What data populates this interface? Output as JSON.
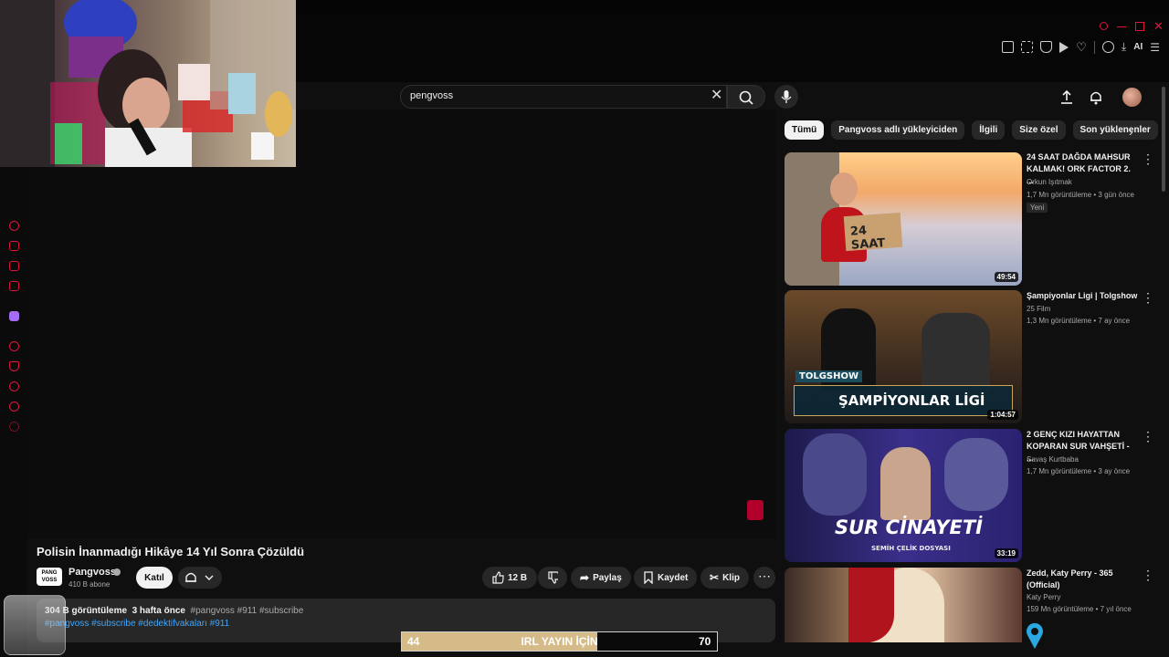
{
  "search": {
    "query": "pengvoss"
  },
  "chips": [
    "Tümü",
    "Pangvoss adlı yükleyiciden",
    "İlgili",
    "Size özel",
    "Son yüklenenler"
  ],
  "toolbar": {
    "ai_label": "AI"
  },
  "video": {
    "title": "Polisin İnanmadığı Hikâye 14 Yıl Sonra Çözüldü",
    "channel": "Pangvoss",
    "channel_logo": "PANG VOSS",
    "subscribers": "410 B abone",
    "join_label": "Katıl",
    "likes": "12 B",
    "share_label": "Paylaş",
    "save_label": "Kaydet",
    "clip_label": "Klip",
    "views": "304 B görüntüleme",
    "age": "3 hafta önce",
    "tags_line1": "#pangvoss #911 #subscribe",
    "tags_line2": "#pangvoss  #subscribe #dedektifvakaları #911"
  },
  "goal": {
    "left": "44",
    "label": "IRL YAYIN İÇİN",
    "right": "70",
    "progress_fraction": 0.62
  },
  "recommendations": [
    {
      "title": "24 SAAT DAĞDA MAHSUR KALMAK! ORK FACTOR 2. ...",
      "channel": "Orkun Işıtmak",
      "meta": "1,7 Mn görüntüleme • 3 gün önce",
      "badge": "Yeni",
      "duration": "49:54",
      "thumb_text": "24 SAAT"
    },
    {
      "title": "Şampiyonlar Ligi | Tolgshow",
      "channel": "25 Film",
      "meta": "1,3 Mn görüntüleme • 7 ay önce",
      "duration": "1:04:57",
      "thumb_text": "ŞAMPİYONLAR LİGİ",
      "thumb_text2": "TOLGSHOW"
    },
    {
      "title": "2 GENÇ KIZI HAYATTAN KOPARAN SUR VAHŞETİ - ...",
      "channel": "Savaş Kurtbaba",
      "meta": "1,7 Mn görüntüleme • 3 ay önce",
      "duration": "33:19",
      "thumb_text": "SUR CİNAYETİ",
      "thumb_text2": "SEMİH ÇELİK DOSYASI"
    },
    {
      "title": "Zedd, Katy Perry - 365 (Official)",
      "channel": "Katy Perry",
      "meta": "159 Mn görüntüleme • 7 yıl önce"
    }
  ],
  "colors": {
    "accent": "#e0143c",
    "background": "#0f0f0f",
    "goal_fill": "#d4bb88"
  }
}
